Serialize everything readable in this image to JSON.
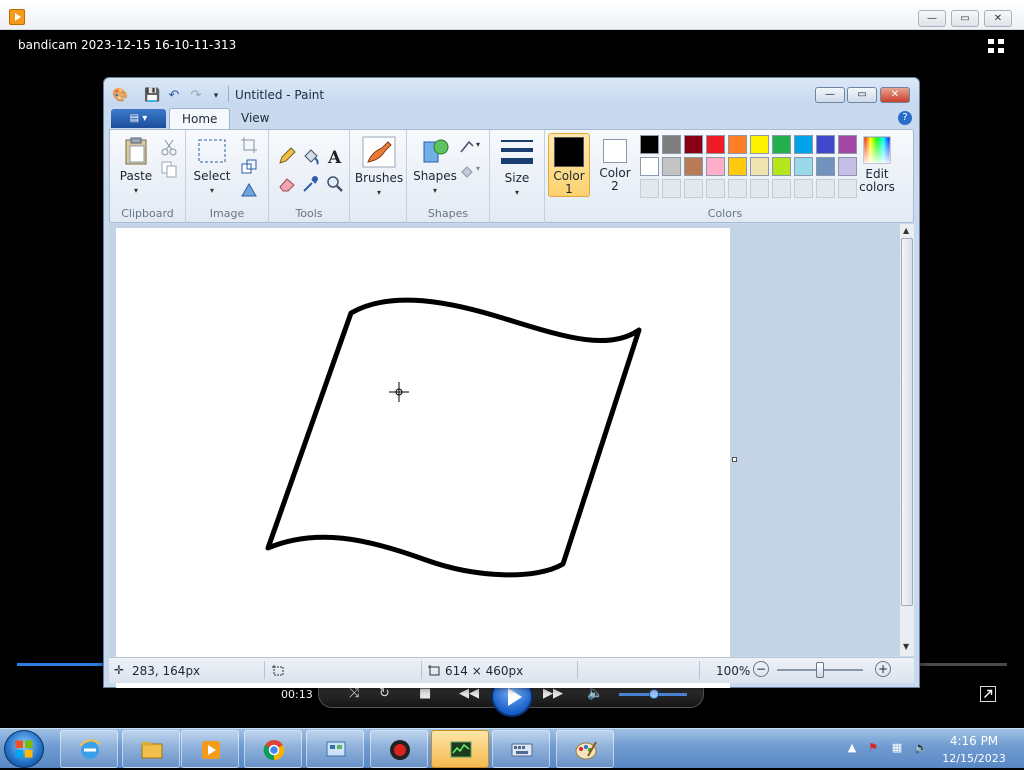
{
  "player": {
    "file_title": "bandicam 2023-12-15 16-10-11-313",
    "elapsed_time": "00:13",
    "progress_fraction": 0.09,
    "window_controls": {
      "minimize": "—",
      "maximize": "▭",
      "close": "✕"
    }
  },
  "paint": {
    "window_title": "Untitled - Paint",
    "window_controls": {
      "minimize": "—",
      "maximize": "▭",
      "close": "✕"
    },
    "tabs": [
      {
        "label": "Home",
        "active": true
      },
      {
        "label": "View",
        "active": false
      }
    ],
    "help_label": "?",
    "groups": {
      "clipboard": {
        "label": "Clipboard",
        "paste": "Paste"
      },
      "image": {
        "label": "Image",
        "select": "Select"
      },
      "tools": {
        "label": "Tools"
      },
      "brushes": {
        "label": "Brushes"
      },
      "shapes": {
        "label": "Shapes",
        "shapes_button": "Shapes"
      },
      "size": {
        "label": "Size"
      },
      "colors": {
        "label": "Colors",
        "color1": "Color",
        "color1_num": "1",
        "color2": "Color",
        "color2_num": "2",
        "edit_colors_line1": "Edit",
        "edit_colors_line2": "colors"
      }
    },
    "color1_value": "#000000",
    "color2_value": "#ffffff",
    "palette_row1": [
      "#000000",
      "#7f7f7f",
      "#880015",
      "#ed1c24",
      "#ff7f27",
      "#fff200",
      "#22b14c",
      "#00a2e8",
      "#3f48cc",
      "#a349a4"
    ],
    "palette_row2": [
      "#ffffff",
      "#c3c3c3",
      "#b97a57",
      "#ffaec9",
      "#ffc90e",
      "#efe4b0",
      "#b5e61d",
      "#99d9ea",
      "#7092be",
      "#c8bfe7"
    ],
    "status": {
      "cursor_position": "283, 164px",
      "canvas_size": "614 × 460px",
      "zoom": "100%"
    }
  },
  "taskbar": {
    "time": "4:16 PM",
    "date": "12/15/2023",
    "apps": [
      {
        "name": "internet-explorer",
        "active": false
      },
      {
        "name": "file-explorer",
        "active": false
      },
      {
        "name": "media-player",
        "active": false
      },
      {
        "name": "chrome",
        "active": false
      },
      {
        "name": "control-panel",
        "active": false
      },
      {
        "name": "bandicam",
        "active": false
      },
      {
        "name": "task-manager",
        "active": true
      },
      {
        "name": "on-screen-keyboard",
        "active": false
      },
      {
        "name": "paint",
        "active": false
      }
    ]
  }
}
